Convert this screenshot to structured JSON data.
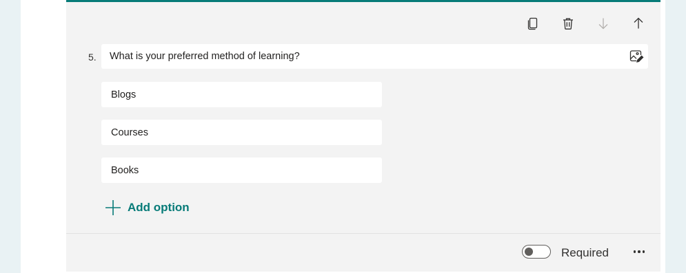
{
  "theme": {
    "accent": "#077b78",
    "card_bg": "#f3f3f3"
  },
  "toolbar": {
    "items": [
      {
        "icon": "copy-icon",
        "label": "Copy question"
      },
      {
        "icon": "delete-icon",
        "label": "Delete question"
      },
      {
        "icon": "arrow-down-icon",
        "label": "Move question down",
        "disabled": true
      },
      {
        "icon": "arrow-up-icon",
        "label": "Move question up"
      }
    ]
  },
  "question": {
    "number": "5.",
    "text": "What is your preferred method of learning?",
    "image_button_icon": "image-edit-icon"
  },
  "options": [
    {
      "label": "Blogs"
    },
    {
      "label": "Courses"
    },
    {
      "label": "Books"
    }
  ],
  "add_option": {
    "label": "Add option",
    "icon": "plus-icon"
  },
  "footer": {
    "required_label": "Required",
    "required_on": false,
    "more_icon": "more-icon"
  }
}
